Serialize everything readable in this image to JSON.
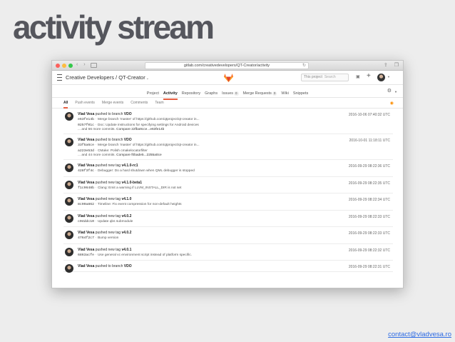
{
  "slide": {
    "title": "activity stream",
    "footer_link": "contact@vladvesa.ro"
  },
  "browser": {
    "address": "gitlab.com/creativedevelopers/QT-Creator/activity"
  },
  "header": {
    "project_title": "Creative Developers / QT-Creator",
    "search_scope": "This project",
    "search_placeholder": "Search"
  },
  "project_tabs": [
    {
      "label": "Project"
    },
    {
      "label": "Activity",
      "active": true
    },
    {
      "label": "Repository"
    },
    {
      "label": "Graphs"
    },
    {
      "label": "Issues",
      "badge": "0"
    },
    {
      "label": "Merge Requests",
      "badge": "0"
    },
    {
      "label": "Wiki"
    },
    {
      "label": "Snippets"
    }
  ],
  "filter_tabs": [
    {
      "label": "All",
      "active": true
    },
    {
      "label": "Push events"
    },
    {
      "label": "Merge events"
    },
    {
      "label": "Comments"
    },
    {
      "label": "Team"
    }
  ],
  "events": [
    {
      "author": "Vlad Vesa",
      "action": "pushed to branch",
      "ref": "VDO",
      "time": "2016-10-06 07:40:32 UTC",
      "commits": [
        {
          "sha": "e63fe14b",
          "msg": "Merge branch 'master' of https://github.com/qtproject/qt-creator in..."
        },
        {
          "sha": "0257f01c",
          "msg": "Doc: Update instructions for specifying settings for Android devices"
        }
      ],
      "more": "... and 66 more commits.",
      "compare": "Compare 22fba9cce...e63fe14b"
    },
    {
      "author": "Vlad Vesa",
      "action": "pushed to branch",
      "ref": "VDO",
      "time": "2016-10-01 11:18:11 UTC",
      "commits": [
        {
          "sha": "33f5a6ce",
          "msg": "Merge branch 'master' of https://github.com/qtproject/qt-creator in..."
        },
        {
          "sha": "a223e53d",
          "msg": "CMake: Polish cmakelocatorfilter"
        }
      ],
      "more": "... and 44 more commits.",
      "compare": "Compare f0bade5...2255a0ce"
    },
    {
      "author": "Vlad Vesa",
      "action": "pushed new tag",
      "ref": "v4.1.0-rc1",
      "time": "2016-09-29 08:22:36 UTC",
      "commits": [
        {
          "sha": "428f3f4c",
          "msg": "Debugger: Do a hard shutdown when QML debugger is stopped"
        }
      ]
    },
    {
      "author": "Vlad Vesa",
      "action": "pushed new tag",
      "ref": "v4.1.0-beta1",
      "time": "2016-09-29 08:22:35 UTC",
      "commits": [
        {
          "sha": "f1c9648b",
          "msg": "Clang: Emit a warning if LLVM_INSTALL_DIR is not set"
        }
      ]
    },
    {
      "author": "Vlad Vesa",
      "action": "pushed new tag",
      "ref": "v4.1.0",
      "time": "2016-09-29 08:22:34 UTC",
      "commits": [
        {
          "sha": "8c90a862",
          "msg": "Timeline: Fix event compression for non-default heights"
        }
      ]
    },
    {
      "author": "Vlad Vesa",
      "action": "pushed new tag",
      "ref": "v4.0.2",
      "time": "2016-09-29 08:22:33 UTC",
      "commits": [
        {
          "sha": "c04ddc10",
          "msg": "Update qbs submodule"
        }
      ]
    },
    {
      "author": "Vlad Vesa",
      "action": "pushed new tag",
      "ref": "v4.0.2",
      "time": "2016-09-29 08:22:33 UTC",
      "commits": [
        {
          "sha": "4764f2c7",
          "msg": "Bump version"
        }
      ]
    },
    {
      "author": "Vlad Vesa",
      "action": "pushed new tag",
      "ref": "v4.0.1",
      "time": "2016-09-29 08:22:32 UTC",
      "commits": [
        {
          "sha": "6863acfe",
          "msg": "Use general vc environment script instead of platform specific."
        }
      ]
    },
    {
      "author": "Vlad Vesa",
      "action": "pushed to branch",
      "ref": "VDO",
      "time": "2016-09-29 08:22:31 UTC",
      "commits": []
    }
  ]
}
